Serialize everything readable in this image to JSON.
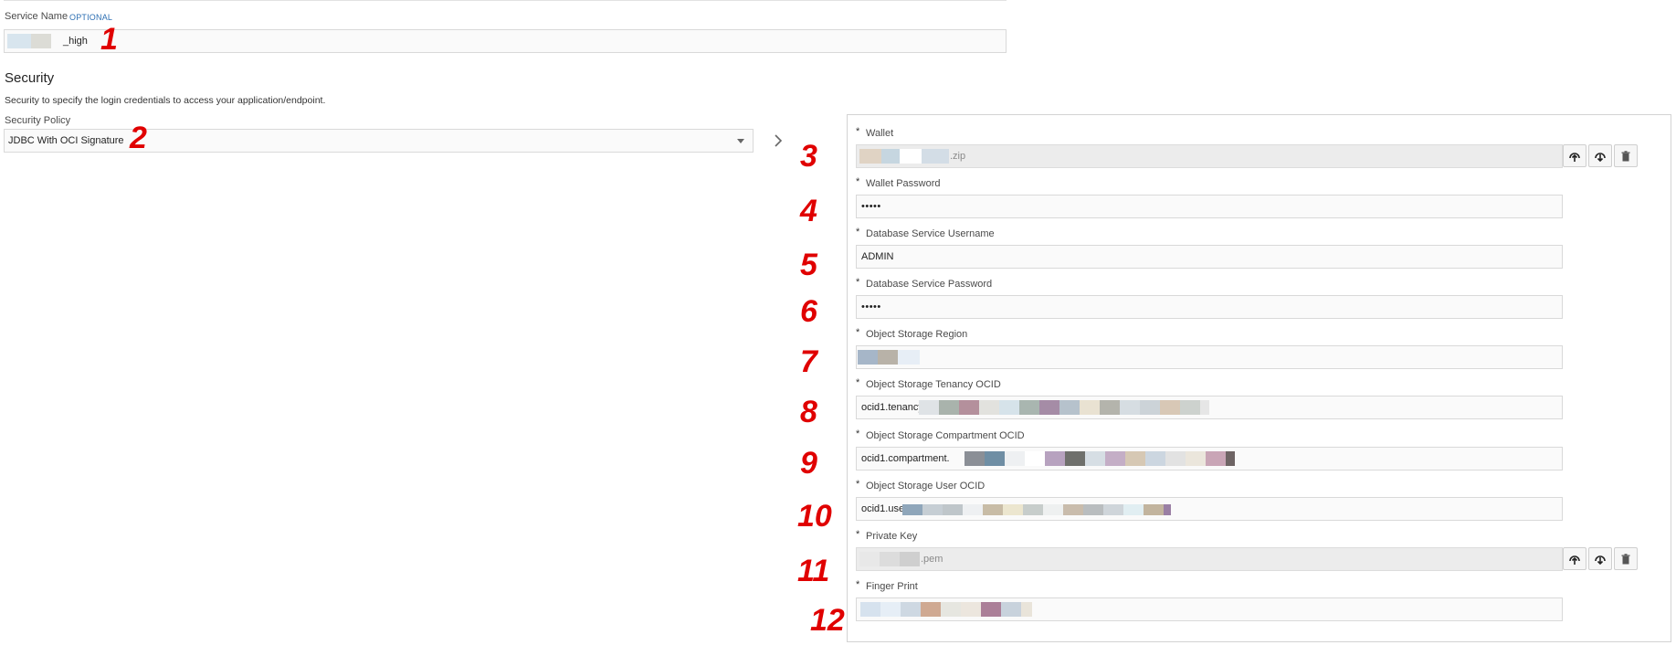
{
  "service_name": {
    "label": "Service Name",
    "optional_tag": "OPTIONAL",
    "value_suffix": "_high"
  },
  "security": {
    "heading": "Security",
    "description": "Security to specify the login credentials to access your application/endpoint.",
    "policy_label": "Security Policy",
    "policy_value": "JDBC With OCI Signature"
  },
  "panel": {
    "required_marker": "*",
    "wallet": {
      "label": "Wallet",
      "file_suffix": ".zip"
    },
    "wallet_password": {
      "label": "Wallet Password",
      "value": "•••••"
    },
    "db_username": {
      "label": "Database Service Username",
      "value": "ADMIN"
    },
    "db_password": {
      "label": "Database Service Password",
      "value": "•••••"
    },
    "region": {
      "label": "Object Storage Region"
    },
    "tenancy_ocid": {
      "label": "Object Storage Tenancy OCID",
      "value_prefix": "ocid1.tenancy"
    },
    "compartment_ocid": {
      "label": "Object Storage Compartment OCID",
      "value_prefix": "ocid1.compartment."
    },
    "user_ocid": {
      "label": "Object Storage User OCID",
      "value_prefix": "ocid1.user"
    },
    "private_key": {
      "label": "Private Key",
      "file_suffix": ".pem"
    },
    "fingerprint": {
      "label": "Finger Print"
    }
  },
  "annotations": [
    "1",
    "2",
    "3",
    "4",
    "5",
    "6",
    "7",
    "8",
    "9",
    "10",
    "11",
    "12"
  ],
  "icons": {
    "upload": "upload-icon",
    "download": "download-icon",
    "delete": "trash-icon",
    "chevron": "chevron-right-icon",
    "dropdown": "chevron-down-icon"
  },
  "colors": {
    "annotation": "#e00000",
    "optional": "#2d6fb3",
    "readonly_field": "#ececec"
  }
}
